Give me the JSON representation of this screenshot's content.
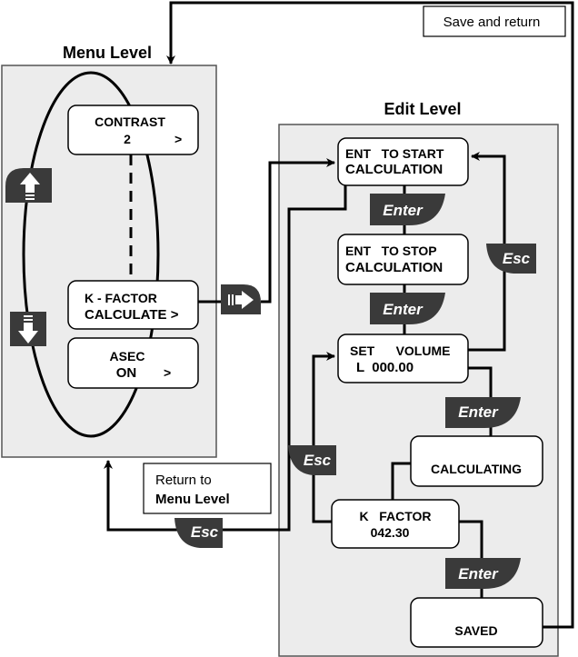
{
  "menu_level": {
    "title": "Menu Level",
    "items": [
      {
        "line1": "CONTRAST",
        "line2": "2",
        "arrow": ">"
      },
      {
        "line1": "K - FACTOR",
        "line2": "CALCULATE >"
      },
      {
        "line1": "ASEC",
        "line2": "ON",
        "arrow": ">"
      }
    ],
    "up_icon": "arrow-up-key-icon",
    "down_icon": "arrow-down-key-icon",
    "right_icon": "arrow-right-key-icon"
  },
  "edit_level": {
    "title": "Edit Level",
    "start": {
      "line1": "ENT   TO START",
      "line2": "CALCULATION"
    },
    "stop": {
      "line1": "ENT   TO STOP",
      "line2": "CALCULATION"
    },
    "volume": {
      "line1": "SET      VOLUME",
      "line2": "L  000.00"
    },
    "calculating": "CALCULATING",
    "kfactor": {
      "line1": "K   FACTOR",
      "line2": "042.30"
    },
    "saved": "SAVED"
  },
  "keys": {
    "enter": "Enter",
    "esc": "Esc"
  },
  "labels": {
    "save_return": "Save and return",
    "return_to": "Return to",
    "return_menu": "Menu Level"
  },
  "colors": {
    "panel": "#ececec",
    "key": "#3a3a3a"
  }
}
